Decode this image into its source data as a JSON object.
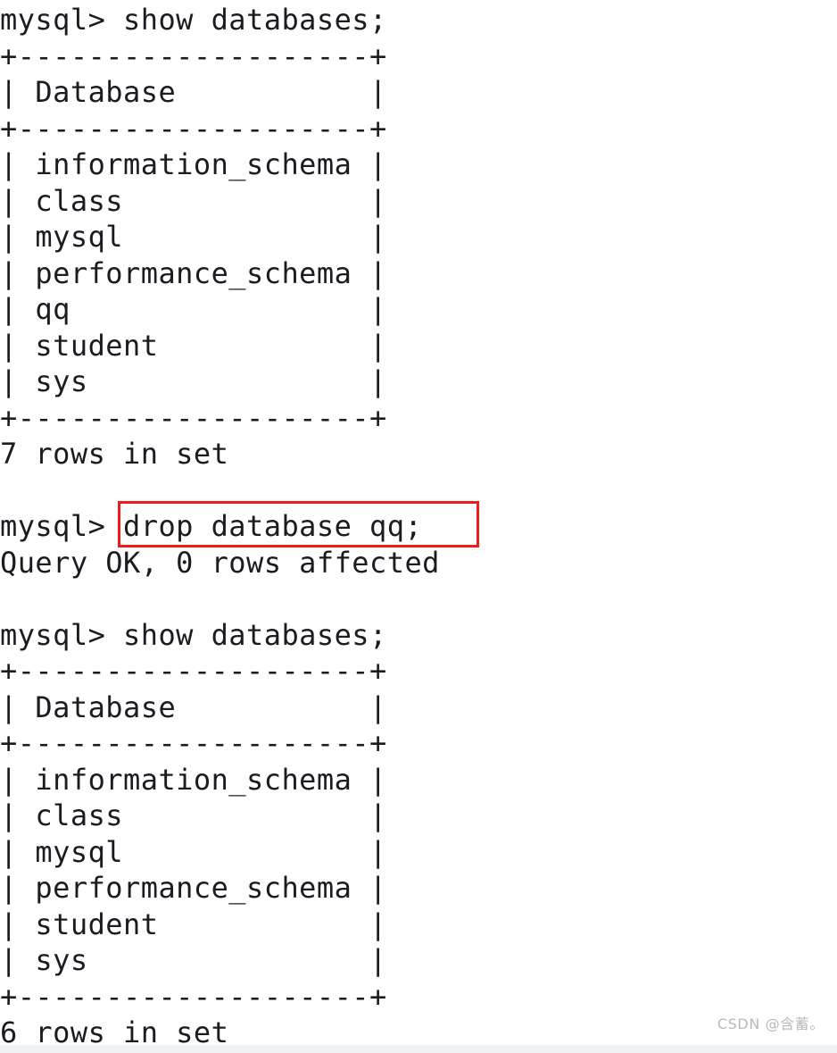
{
  "terminal": {
    "background_color": "#ffffff",
    "text_color": "#1b1b22",
    "prompt": "mysql>",
    "lines": [
      "mysql> show databases;",
      "+--------------------+",
      "| Database           |",
      "+--------------------+",
      "| information_schema |",
      "| class              |",
      "| mysql              |",
      "| performance_schema |",
      "| qq                 |",
      "| student            |",
      "| sys                |",
      "+--------------------+",
      "7 rows in set",
      "",
      "mysql> drop database qq;",
      "Query OK, 0 rows affected",
      "",
      "mysql> show databases;",
      "+--------------------+",
      "| Database           |",
      "+--------------------+",
      "| information_schema |",
      "| class              |",
      "| mysql              |",
      "| performance_schema |",
      "| student            |",
      "| sys                |",
      "+--------------------+",
      "6 rows in set"
    ]
  },
  "commands": {
    "first_show_databases": "show databases;",
    "drop_database": "drop database qq;",
    "second_show_databases": "show databases;"
  },
  "results": {
    "first_table": {
      "column_header": "Database",
      "rows": [
        "information_schema",
        "class",
        "mysql",
        "performance_schema",
        "qq",
        "student",
        "sys"
      ],
      "row_count_text": "7 rows in set"
    },
    "drop_result": "Query OK, 0 rows affected",
    "second_table": {
      "column_header": "Database",
      "rows": [
        "information_schema",
        "class",
        "mysql",
        "performance_schema",
        "student",
        "sys"
      ],
      "row_count_text": "6 rows in set"
    }
  },
  "annotation": {
    "highlight_color": "#ee1c1c",
    "highlighted_text": "drop database qq;"
  },
  "watermark": {
    "text": "CSDN @含蓄。",
    "color": "#b9b9b9"
  }
}
